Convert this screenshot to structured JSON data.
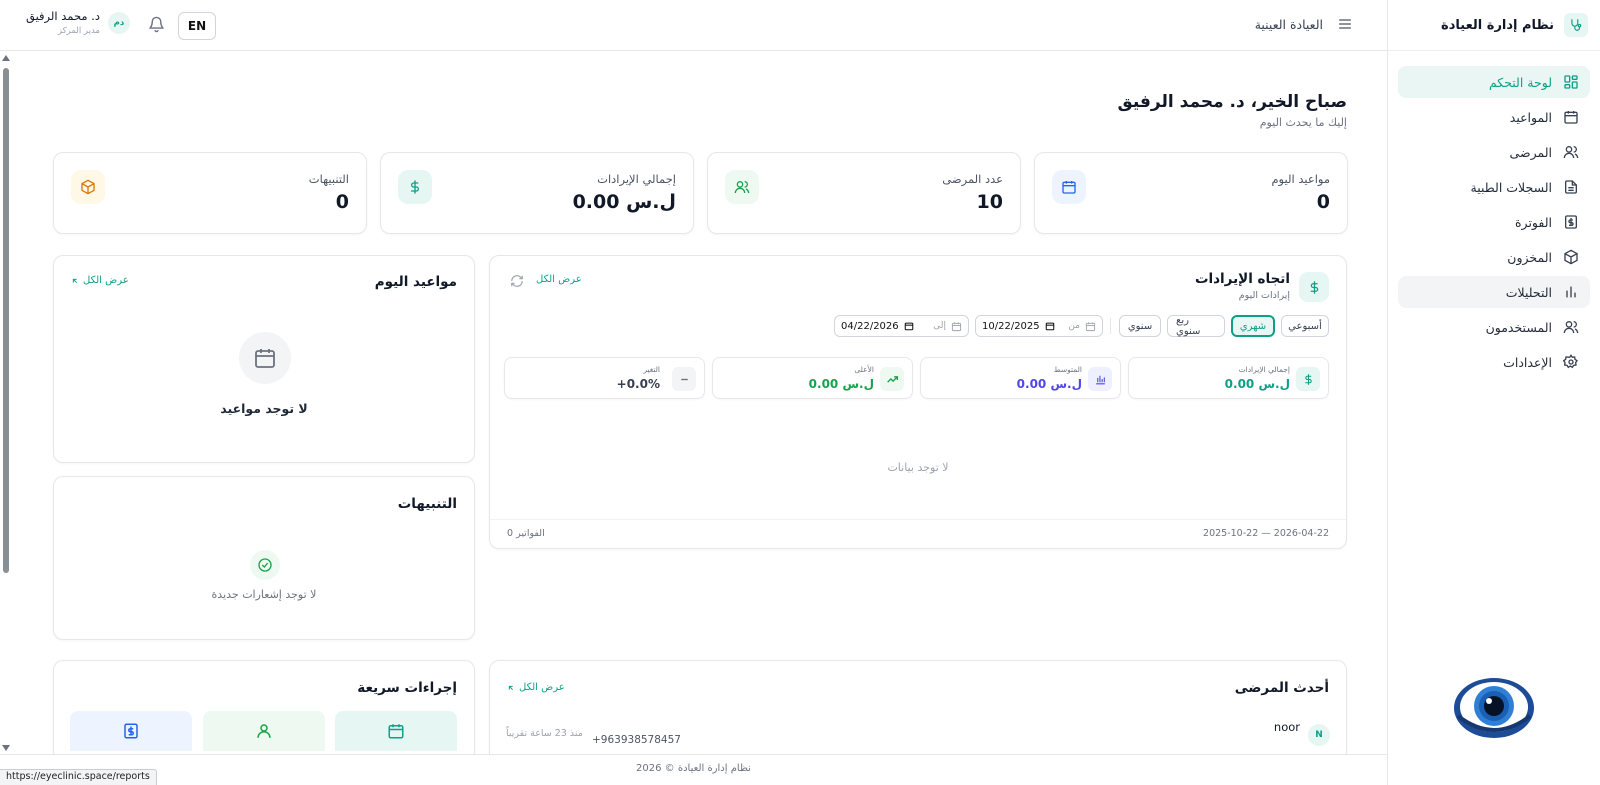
{
  "sidebar": {
    "brand": "نظام إدارة العيادة",
    "items": [
      {
        "label": "لوحة التحكم",
        "icon": "dashboard-icon"
      },
      {
        "label": "المواعيد",
        "icon": "calendar-icon"
      },
      {
        "label": "المرضى",
        "icon": "users-icon"
      },
      {
        "label": "السجلات الطبية",
        "icon": "file-text-icon"
      },
      {
        "label": "الفوترة",
        "icon": "receipt-dollar-icon"
      },
      {
        "label": "المخزون",
        "icon": "package-icon"
      },
      {
        "label": "التحليلات",
        "icon": "bar-chart-icon"
      },
      {
        "label": "المستخدمون",
        "icon": "users-icon"
      },
      {
        "label": "الإعدادات",
        "icon": "gear-icon"
      }
    ]
  },
  "header": {
    "clinic_name": "العيادة العينية",
    "lang_button": "EN",
    "user_name": "د. محمد الرفيق",
    "user_role": "مدير المركز",
    "avatar_initials": "دم"
  },
  "greeting": {
    "title": "صباح الخير، د. محمد الرفيق",
    "subtitle": "إليك ما يحدث اليوم"
  },
  "stats": [
    {
      "label": "مواعيد اليوم",
      "value": "0",
      "icon": "calendar-icon",
      "color": "#2563eb"
    },
    {
      "label": "عدد المرضى",
      "value": "10",
      "icon": "users-icon",
      "color": "#16a34a"
    },
    {
      "label": "إجمالي الإيرادات",
      "value": "0.00 ل.س",
      "icon": "dollar-icon",
      "color": "#0f9f86"
    },
    {
      "label": "التنبيهات",
      "value": "0",
      "icon": "package-icon",
      "color": "#d97706"
    }
  ],
  "revenue": {
    "title": "اتجاه الإيرادات",
    "subtitle": "إيرادات اليوم",
    "view_all": "عرض الكل",
    "periods": [
      "أسبوعي",
      "شهري",
      "ربع سنوي",
      "سنوي"
    ],
    "active_period": "شهري",
    "from_label": "من",
    "from_date": "10/22/2025",
    "to_label": "إلى",
    "to_date": "04/22/2026",
    "metrics": [
      {
        "label": "إجمالي الإيرادات",
        "value": "0.00 ل.س",
        "icon": "dollar-icon"
      },
      {
        "label": "المتوسط",
        "value": "0.00 ل.س",
        "icon": "bar-chart-icon"
      },
      {
        "label": "الأعلى",
        "value": "0.00 ل.س",
        "icon": "trending-up-icon"
      },
      {
        "label": "التغير",
        "value": "+0.0%",
        "icon": "minus-icon"
      }
    ],
    "no_data": "لا توجد بيانات",
    "range_text": "2025-10-22 — 2026-04-22",
    "invoices_text": "0 الفواتير"
  },
  "today_appointments": {
    "title": "مواعيد اليوم",
    "view_all": "عرض الكل",
    "empty": "لا توجد مواعيد"
  },
  "alerts": {
    "title": "التنبيهات",
    "empty": "لا توجد إشعارات جديدة"
  },
  "recent_patients": {
    "title": "أحدث المرضى",
    "view_all": "عرض الكل",
    "rows": [
      {
        "initial": "N",
        "name": "noor",
        "phone": "+963938578457",
        "time": "منذ 23 ساعة تقريباً"
      }
    ]
  },
  "quick_actions": {
    "title": "إجراءات سريعة",
    "items": [
      {
        "icon": "calendar-icon",
        "color": "#e6f6f2"
      },
      {
        "icon": "user-icon",
        "color": "#eefaf1"
      },
      {
        "icon": "receipt-dollar-icon",
        "color": "#eef4ff"
      }
    ]
  },
  "footer": {
    "text": "نظام إدارة العيادة © 2026",
    "status_url": "https://eyeclinic.space/reports"
  }
}
